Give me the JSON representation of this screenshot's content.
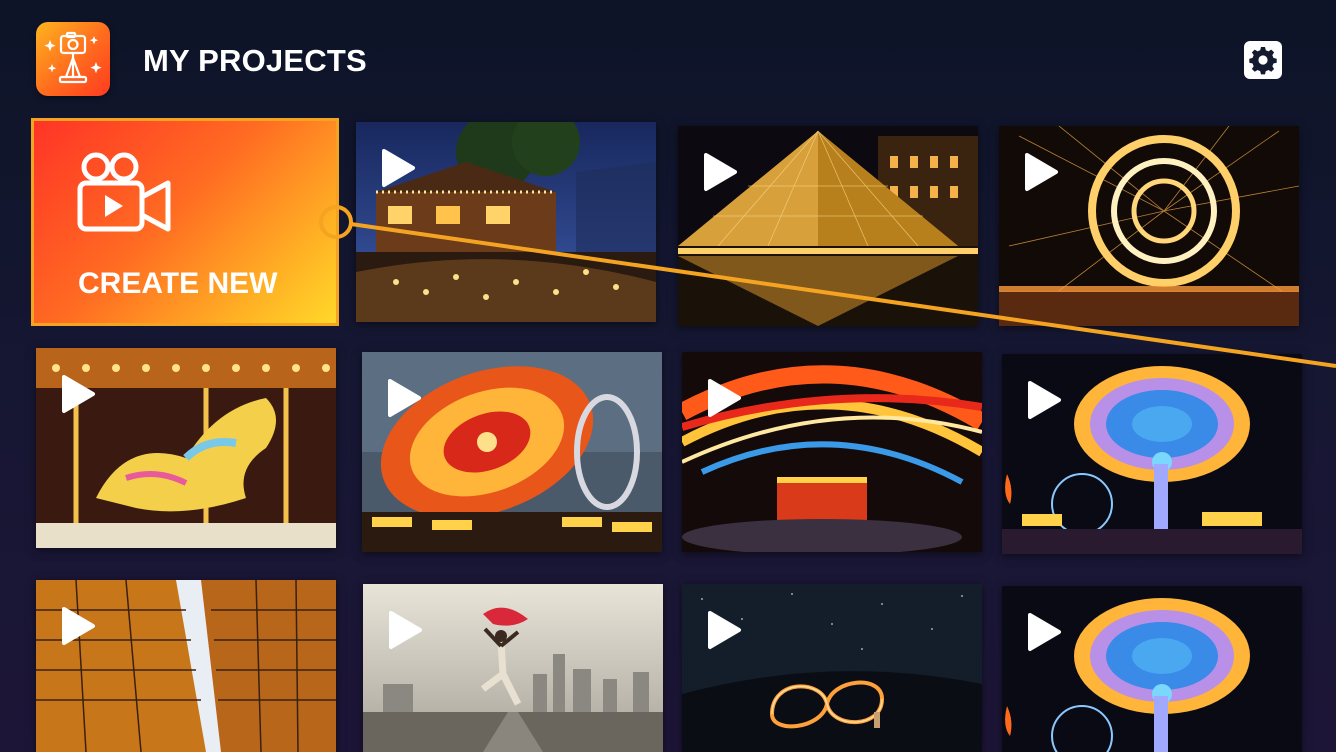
{
  "header": {
    "title": "MY PROJECTS",
    "logo_icon": "photo-editor-app-icon",
    "settings_icon": "gear-icon"
  },
  "create_new": {
    "label": "CREATE NEW",
    "icon": "video-camera-play-icon"
  },
  "colors": {
    "background": "#131630",
    "accent_orange": "#f5a422",
    "create_gradient_start": "#ff3426",
    "create_gradient_end": "#ffd82a",
    "text": "#ffffff"
  },
  "projects": [
    {
      "scene": "christmas-lights-house",
      "icon": "play-icon"
    },
    {
      "scene": "louvre-pyramid-night",
      "icon": "play-icon"
    },
    {
      "scene": "steel-wool-light-circles",
      "icon": "play-icon"
    },
    {
      "scene": "carousel-horse",
      "icon": "play-icon"
    },
    {
      "scene": "spinning-ride-orange",
      "icon": "play-icon"
    },
    {
      "scene": "light-trails-carnival",
      "icon": "play-icon"
    },
    {
      "scene": "spinning-ride-blue",
      "icon": "play-icon"
    },
    {
      "scene": "skyscrapers-upward",
      "icon": "play-icon"
    },
    {
      "scene": "dancer-red-scarf",
      "icon": "play-icon"
    },
    {
      "scene": "infinity-light-painting",
      "icon": "play-icon"
    },
    {
      "scene": "spinning-ride-blue",
      "icon": "play-icon"
    }
  ]
}
